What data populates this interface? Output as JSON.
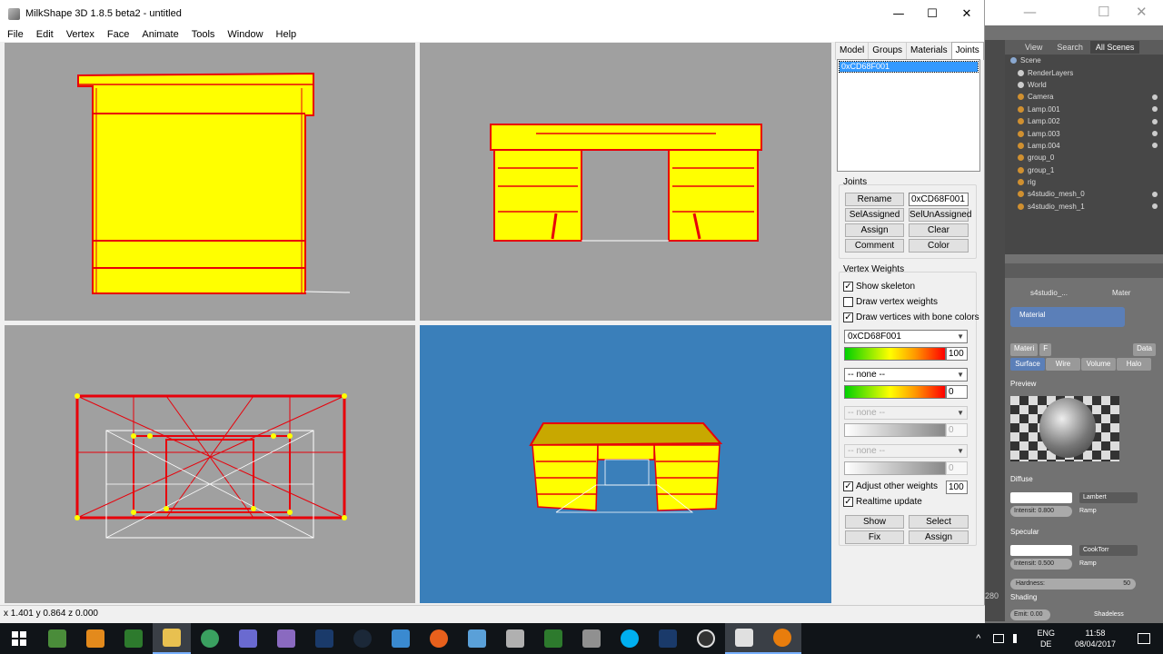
{
  "window": {
    "title": "MilkShape 3D 1.8.5 beta2 - untitled",
    "min_glyph": "—",
    "max_glyph": "☐",
    "close_glyph": "✕"
  },
  "menu": [
    "File",
    "Edit",
    "Vertex",
    "Face",
    "Animate",
    "Tools",
    "Window",
    "Help"
  ],
  "tabs": [
    "Model",
    "Groups",
    "Materials",
    "Joints"
  ],
  "active_tab": "Joints",
  "joints": {
    "list": [
      "0xCD68F001"
    ],
    "group_label": "Joints",
    "rename_label": "Rename",
    "rename_value": "0xCD68F001",
    "sel_assigned_label": "SelAssigned",
    "sel_unassigned_label": "SelUnAssigned",
    "assign_label": "Assign",
    "clear_label": "Clear",
    "comment_label": "Comment",
    "color_label": "Color"
  },
  "vertex_weights": {
    "group_label": "Vertex Weights",
    "show_skeleton": {
      "label": "Show skeleton",
      "checked": true
    },
    "draw_vertex_weights": {
      "label": "Draw vertex weights",
      "checked": false
    },
    "draw_bone_colors": {
      "label": "Draw vertices with bone colors",
      "checked": true
    },
    "bone1": {
      "name": "0xCD68F001",
      "value": "100"
    },
    "bone2": {
      "name": "-- none --",
      "value": "0"
    },
    "bone3": {
      "name": "-- none --",
      "value": "0"
    },
    "bone4": {
      "name": "-- none --",
      "value": "0"
    },
    "adjust_other": {
      "label": "Adjust other weights",
      "checked": true,
      "value": "100"
    },
    "realtime": {
      "label": "Realtime update",
      "checked": true
    },
    "show_label": "Show",
    "select_label": "Select",
    "fix_label": "Fix",
    "assign_label": "Assign"
  },
  "status": "x 1.401 y 0.864 z 0.000",
  "blender": {
    "header_tabs": [
      "View",
      "Search",
      "All Scenes"
    ],
    "outliner": [
      "Scene",
      "RenderLayers",
      "World",
      "Camera",
      "Lamp.001",
      "Lamp.002",
      "Lamp.003",
      "Lamp.004",
      "group_0",
      "group_1",
      "rig",
      "s4studio_mesh_0",
      "s4studio_mesh_1"
    ],
    "crumb_mesh": "s4studio_...",
    "crumb_mat": "Mater",
    "material_slot": "Material",
    "mat_bar": [
      "Materi",
      "F",
      "Data"
    ],
    "shader_tabs": [
      "Surface",
      "Wire",
      "Volume",
      "Halo"
    ],
    "preview_label": "Preview",
    "diffuse_label": "Diffuse",
    "diffuse_shader": "Lambert",
    "diffuse_intensity": "Intensit: 0.800",
    "ramp_label": "Ramp",
    "specular_label": "Specular",
    "specular_shader": "CookTorr",
    "specular_intensity": "Intensit: 0.500",
    "hardness_label": "Hardness:",
    "hardness_value": "50",
    "shading_label": "Shading",
    "emit_value": "Emit: 0.00",
    "shadeless_label": "Shadeless",
    "frame_number": "280"
  },
  "taskbar": {
    "language": "ENG",
    "locale": "DE",
    "time": "11:58",
    "date": "08/04/2017",
    "tray_chevron": "^"
  },
  "colors": {
    "viewport_grey": "#a0a0a0",
    "viewport_3d": "#3a7fba",
    "model_yellow": "#ffff00",
    "edge_red": "#e8000a",
    "selection_blue": "#3399ff"
  }
}
